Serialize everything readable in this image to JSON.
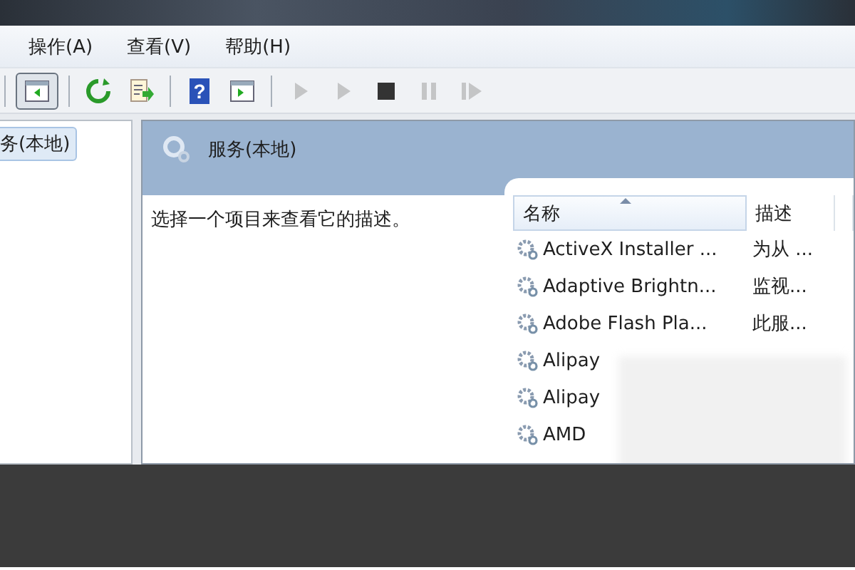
{
  "menu": [
    {
      "label": "操作(A)"
    },
    {
      "label": "查看(V)"
    },
    {
      "label": "帮助(H)"
    }
  ],
  "toolbar": [
    {
      "kind": "tree",
      "pressed": true,
      "disabled": false
    },
    {
      "kind": "sep"
    },
    {
      "kind": "refresh",
      "pressed": false,
      "disabled": false
    },
    {
      "kind": "export",
      "pressed": false,
      "disabled": false
    },
    {
      "kind": "sep"
    },
    {
      "kind": "help",
      "glyph": "?",
      "pressed": false,
      "disabled": false
    },
    {
      "kind": "pane",
      "pressed": false,
      "disabled": false
    },
    {
      "kind": "sep"
    },
    {
      "kind": "play",
      "pressed": false,
      "disabled": true
    },
    {
      "kind": "play",
      "pressed": false,
      "disabled": true
    },
    {
      "kind": "stop",
      "pressed": false,
      "disabled": false
    },
    {
      "kind": "pause",
      "pressed": false,
      "disabled": true
    },
    {
      "kind": "resume",
      "pressed": false,
      "disabled": true
    }
  ],
  "tree": {
    "items": [
      {
        "label": "务(本地)",
        "selected": true
      }
    ]
  },
  "panel": {
    "title": "服务(本地)",
    "description": "选择一个项目来查看它的描述。"
  },
  "table": {
    "columns": [
      {
        "label": "名称",
        "sorted": true
      },
      {
        "label": "描述",
        "sorted": false
      }
    ],
    "rows": [
      {
        "name": "ActiveX Installer ...",
        "description": "为从 ..."
      },
      {
        "name": "Adaptive Brightn...",
        "description": "监视..."
      },
      {
        "name": "Adobe Flash Pla...",
        "description": "此服..."
      },
      {
        "name": "Alipay"
      },
      {
        "name": "Alipay"
      },
      {
        "name": "AMD"
      }
    ]
  }
}
